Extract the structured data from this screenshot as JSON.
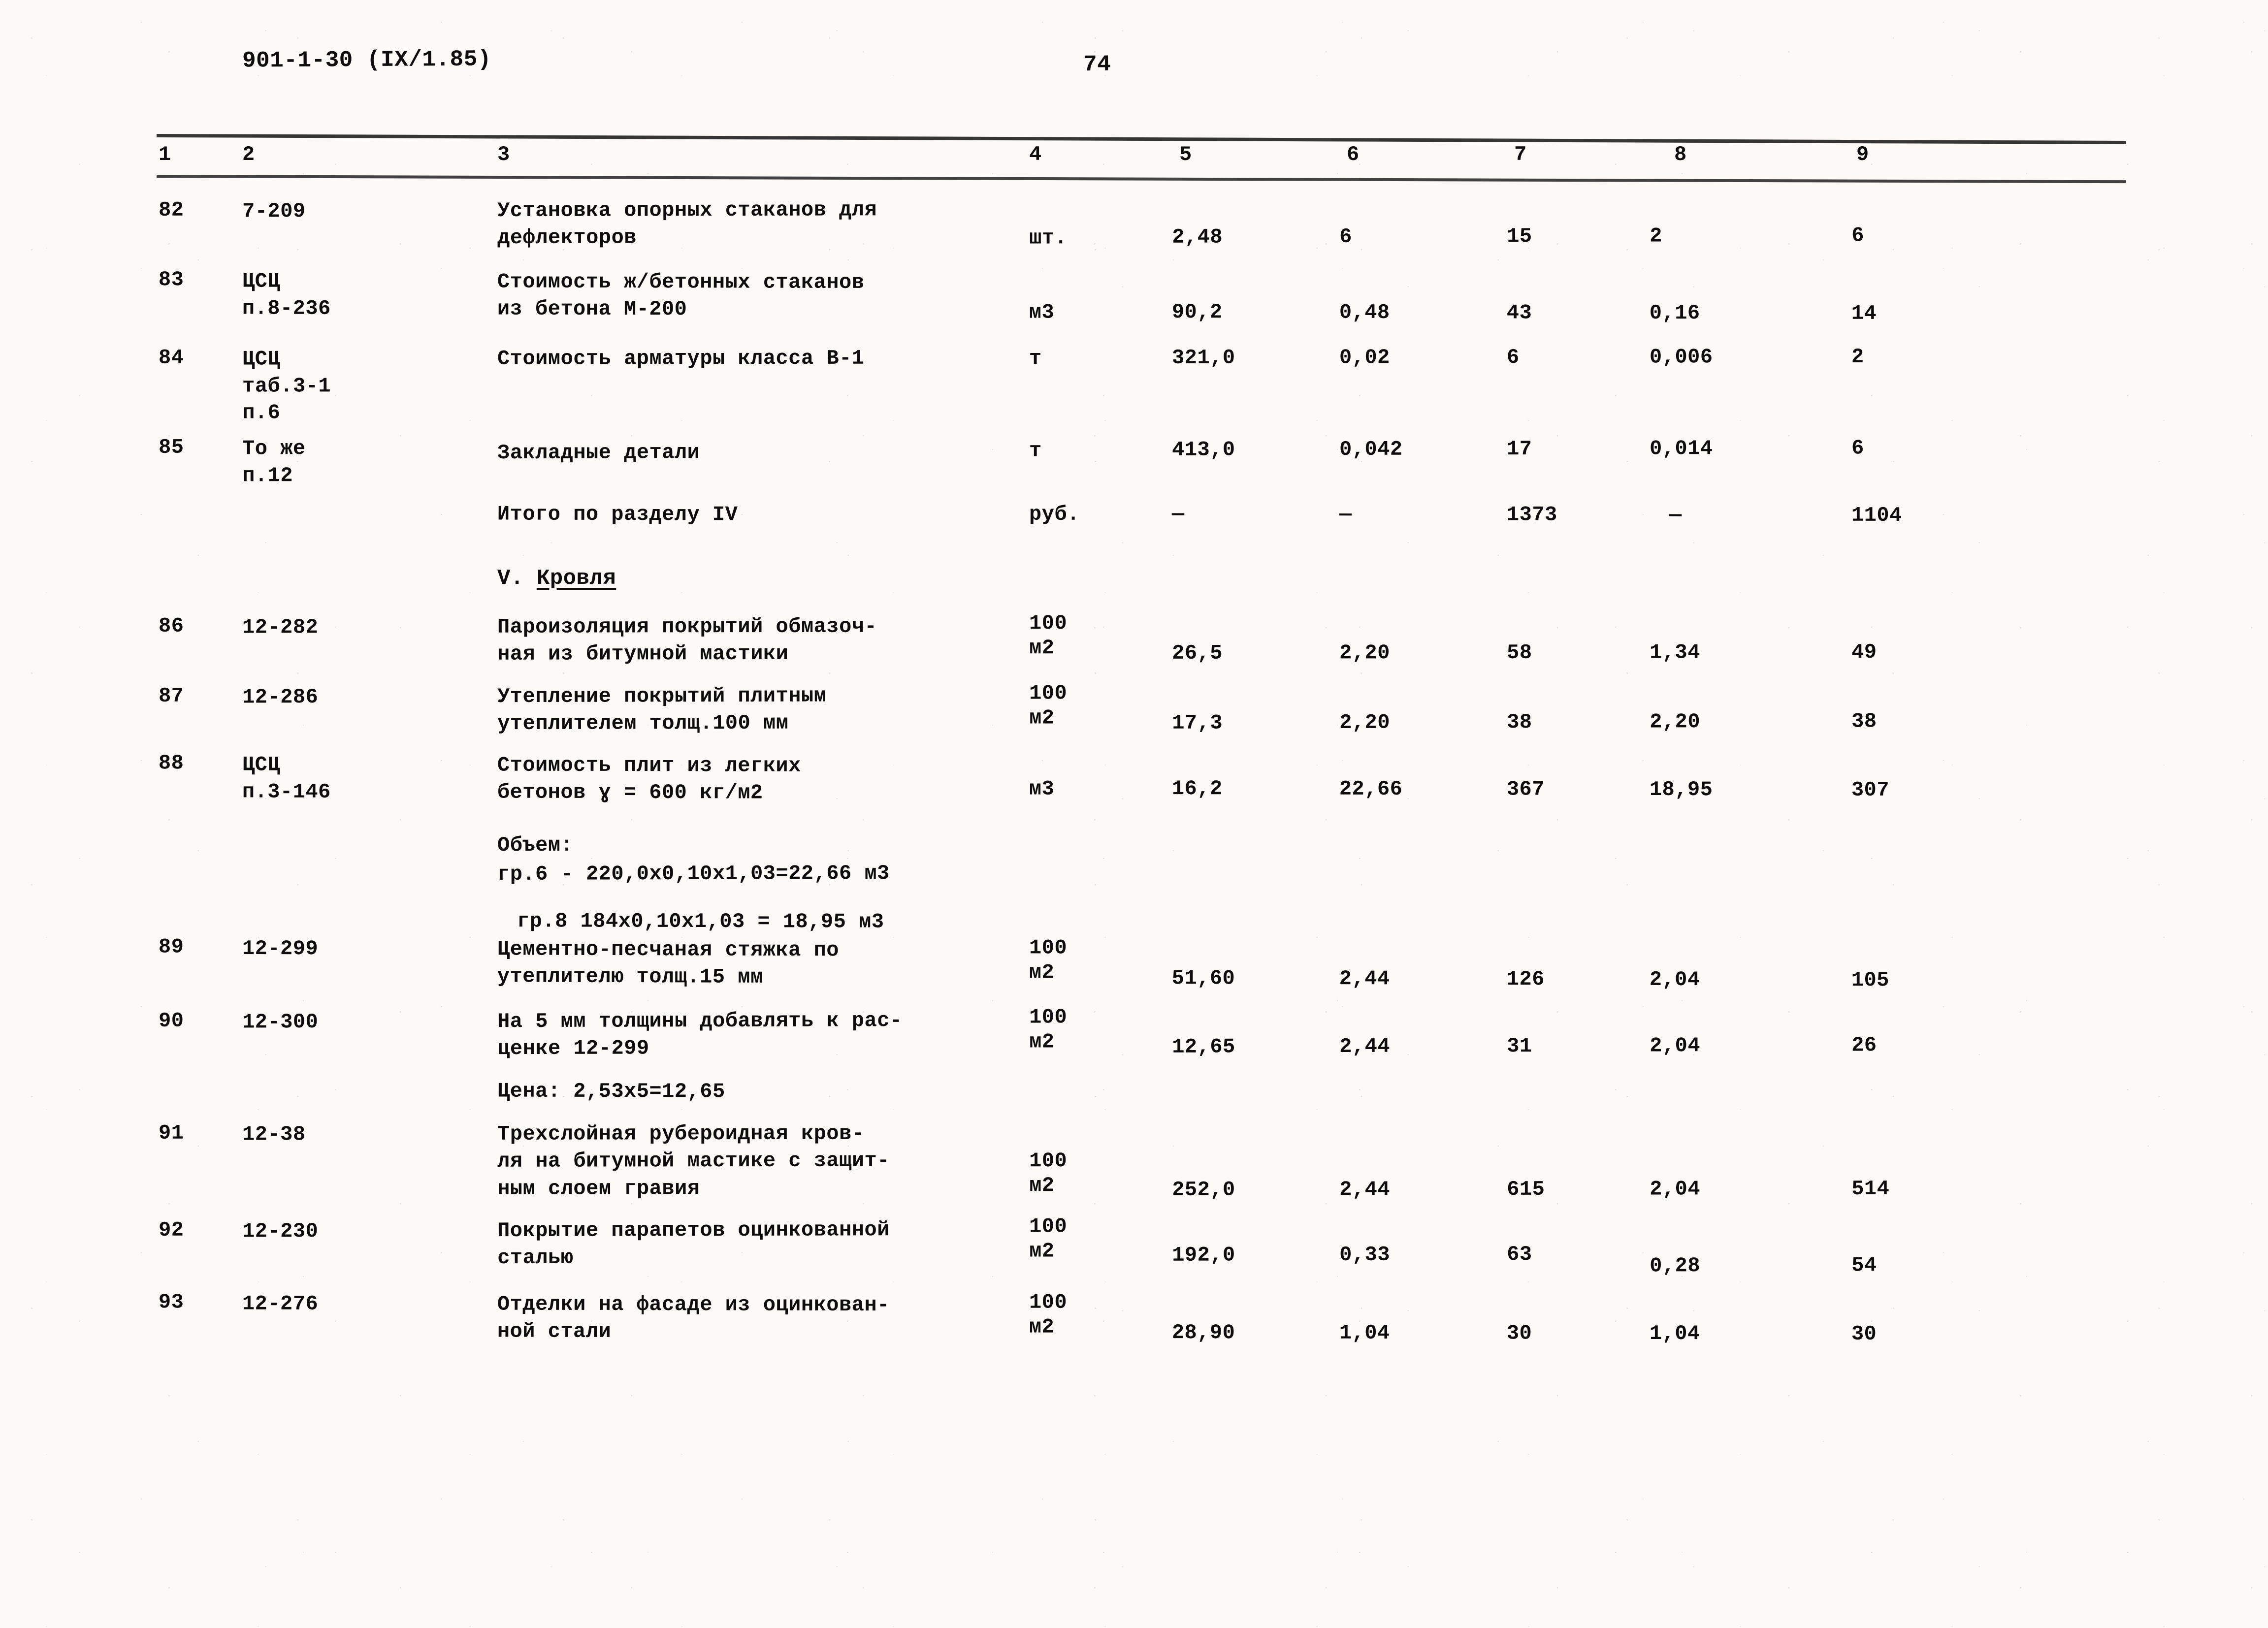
{
  "header": {
    "doc_code": "901-1-30 (IX/1.85)",
    "page_number": "74"
  },
  "table": {
    "column_headers": [
      "1",
      "2",
      "3",
      "4",
      "5",
      "6",
      "7",
      "8",
      "9"
    ],
    "rows": [
      {
        "num": "82",
        "code": "7-209",
        "desc": "Установка опорных стаканов для\nдефлекторов",
        "unit": "шт.",
        "v5": "2,48",
        "v6": "6",
        "v7": "15",
        "v8": "2",
        "v9": "6"
      },
      {
        "num": "83",
        "code": "ЦСЦ\nп.8-236",
        "desc": "Стоимость ж/бетонных стаканов\nиз бетона М-200",
        "unit": "м3",
        "v5": "90,2",
        "v6": "0,48",
        "v7": "43",
        "v8": "0,16",
        "v9": "14"
      },
      {
        "num": "84",
        "code": "ЦСЦ\nтаб.3-1\nп.6",
        "desc": "Стоимость арматуры класса В-1",
        "unit": "т",
        "v5": "321,0",
        "v6": "0,02",
        "v7": "6",
        "v8": "0,006",
        "v9": "2"
      },
      {
        "num": "85",
        "code": "То же\nп.12",
        "desc": "Закладные детали",
        "unit": "т",
        "v5": "413,0",
        "v6": "0,042",
        "v7": "17",
        "v8": "0,014",
        "v9": "6"
      },
      {
        "num": "",
        "code": "",
        "desc": "Итого по разделу IV",
        "unit": "руб.",
        "v5": "—",
        "v6": "—",
        "v7": "1373",
        "v8": "—",
        "v9": "1104"
      },
      {
        "num": "86",
        "code": "12-282",
        "desc": "Пароизоляция покрытий обмазоч-\nная из битумной мастики",
        "unit": "100\nм2",
        "v5": "26,5",
        "v6": "2,20",
        "v7": "58",
        "v8": "1,34",
        "v9": "49"
      },
      {
        "num": "87",
        "code": "12-286",
        "desc": "Утепление покрытий плитным\nутеплителем толщ.100 мм",
        "unit": "100\nм2",
        "v5": "17,3",
        "v6": "2,20",
        "v7": "38",
        "v8": "2,20",
        "v9": "38"
      },
      {
        "num": "88",
        "code": "ЦСЦ\nп.3-146",
        "desc": "Стоимость плит из легких\nбетонов ɣ = 600 кг/м2",
        "unit": "м3",
        "v5": "16,2",
        "v6": "22,66",
        "v7": "367",
        "v8": "18,95",
        "v9": "307"
      },
      {
        "num": "89",
        "code": "12-299",
        "desc": "Цементно-песчаная стяжка по\nутеплителю толщ.15 мм",
        "unit": "100\nм2",
        "v5": "51,60",
        "v6": "2,44",
        "v7": "126",
        "v8": "2,04",
        "v9": "105"
      },
      {
        "num": "90",
        "code": "12-300",
        "desc": "На 5 мм толщины добавлять к рас-\nценке 12-299",
        "unit": "100\nм2",
        "v5": "12,65",
        "v6": "2,44",
        "v7": "31",
        "v8": "2,04",
        "v9": "26"
      },
      {
        "num": "91",
        "code": "12-38",
        "desc": "Трехслойная рубероидная кров-\nля на битумной мастике с защит-\nным слоем гравия",
        "unit": "100\nм2",
        "v5": "252,0",
        "v6": "2,44",
        "v7": "615",
        "v8": "2,04",
        "v9": "514"
      },
      {
        "num": "92",
        "code": "12-230",
        "desc": "Покрытие парапетов оцинкованной\nсталью",
        "unit": "100\nм2",
        "v5": "192,0",
        "v6": "0,33",
        "v7": "63",
        "v8": "0,28",
        "v9": "54"
      },
      {
        "num": "93",
        "code": "12-276",
        "desc": "Отделки на фасаде из оцинкован-\nной стали",
        "unit": "100\nм2",
        "v5": "28,90",
        "v6": "1,04",
        "v7": "30",
        "v8": "1,04",
        "v9": "30"
      }
    ],
    "section_heading": {
      "label": "V.",
      "title": "Кровля"
    },
    "notes": [
      {
        "text": "Объем:"
      },
      {
        "text": "гр.6 - 220,0х0,10х1,03=22,66 м3"
      },
      {
        "text": "гр.8   184х0,10х1,03 = 18,95 м3"
      },
      {
        "text": "Цена: 2,53х5=12,65"
      }
    ]
  }
}
